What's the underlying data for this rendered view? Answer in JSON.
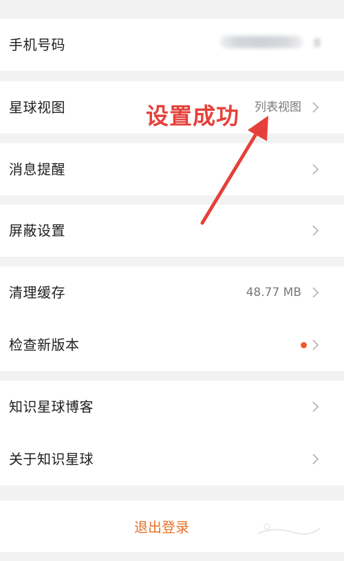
{
  "rows": {
    "phone": {
      "label": "手机号码"
    },
    "planet_view": {
      "label": "星球视图",
      "value": "列表视图"
    },
    "notifications": {
      "label": "消息提醒"
    },
    "privacy": {
      "label": "屏蔽设置"
    },
    "clear_cache": {
      "label": "清理缓存",
      "value": "48.77 MB"
    },
    "check_update": {
      "label": "检查新版本"
    },
    "blog": {
      "label": "知识星球博客"
    },
    "about": {
      "label": "关于知识星球"
    }
  },
  "logout": {
    "label": "退出登录"
  },
  "annotation": {
    "text": "设置成功"
  },
  "colors": {
    "background": "#f2f2f2",
    "card": "#ffffff",
    "logout_text": "#e5702b",
    "annotation": "#e6403a",
    "update_dot": "#ef5a2a"
  },
  "icons": {
    "chevron": "chevron-right-icon",
    "annotation_arrow": "red-arrow-icon"
  }
}
